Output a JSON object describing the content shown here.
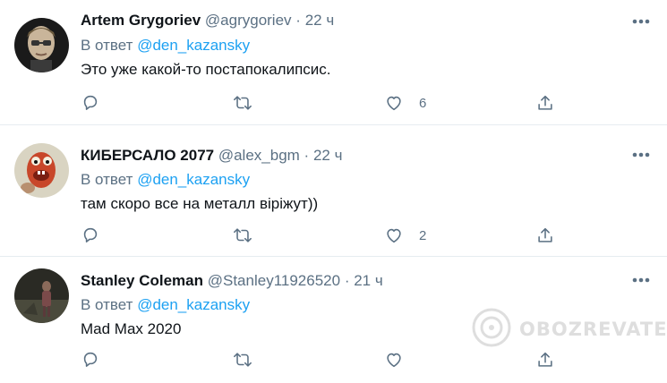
{
  "tweets": [
    {
      "name": "Artem Grygoriev",
      "handle": "@agrygoriev",
      "separator": "·",
      "time": "22 ч",
      "reply_prefix": "В ответ",
      "reply_mention": "@den_kazansky",
      "text": "Это уже какой-то постапокалипсис.",
      "likes": "6"
    },
    {
      "name": "КИБЕРСАЛО 2077",
      "handle": "@alex_bgm",
      "separator": "·",
      "time": "22 ч",
      "reply_prefix": "В ответ",
      "reply_mention": "@den_kazansky",
      "text": "там скоро все на металл віріжут))",
      "likes": "2"
    },
    {
      "name": "Stanley Coleman",
      "handle": "@Stanley11926520",
      "separator": "·",
      "time": "21 ч",
      "reply_prefix": "В ответ",
      "reply_mention": "@den_kazansky",
      "text": "Mad Max 2020",
      "likes": ""
    }
  ],
  "icons": {
    "reply": "reply-icon",
    "retweet": "retweet-icon",
    "like": "heart-icon",
    "share": "share-icon",
    "more": "more-icon"
  },
  "colors": {
    "link": "#1da1f2",
    "secondary_text": "#5b7083",
    "primary_text": "#0f1419",
    "divider": "#e6ecf0"
  },
  "watermark": {
    "text": "OBOZREVATEL"
  }
}
